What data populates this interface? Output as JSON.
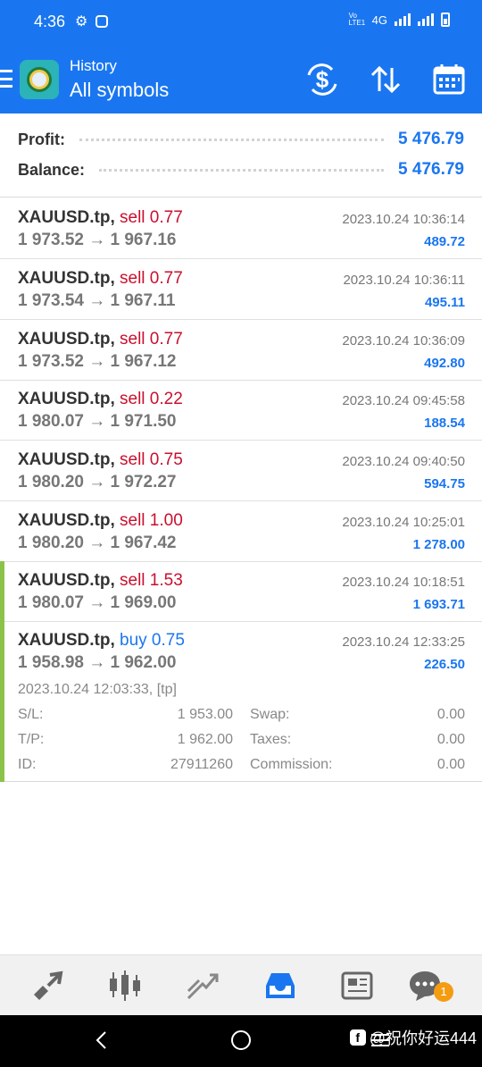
{
  "status_bar": {
    "time": "4:36",
    "icons": [
      "gear-icon",
      "instagram-icon"
    ],
    "network": "4G",
    "volte": "Vo LTE1"
  },
  "app_bar": {
    "subtitle": "History",
    "title": "All symbols",
    "accent_color": "#1a76f0",
    "actions": [
      "currency-exchange-icon",
      "sort-icon",
      "calendar-icon"
    ]
  },
  "summary": {
    "profit_label": "Profit:",
    "profit_value": "5 476.79",
    "balance_label": "Balance:",
    "balance_value": "5 476.79"
  },
  "trades": [
    {
      "symbol": "XAUUSD.tp,",
      "side": "sell 0.77",
      "prices": "1 973.52 → 1 967.16",
      "time": "2023.10.24 10:36:14",
      "profit": "489.72"
    },
    {
      "symbol": "XAUUSD.tp,",
      "side": "sell 0.77",
      "prices": "1 973.54 → 1 967.11",
      "time": "2023.10.24 10:36:11",
      "profit": "495.11"
    },
    {
      "symbol": "XAUUSD.tp,",
      "side": "sell 0.77",
      "prices": "1 973.52 → 1 967.12",
      "time": "2023.10.24 10:36:09",
      "profit": "492.80"
    },
    {
      "symbol": "XAUUSD.tp,",
      "side": "sell 0.22",
      "prices": "1 980.07 → 1 971.50",
      "time": "2023.10.24 09:45:58",
      "profit": "188.54"
    },
    {
      "symbol": "XAUUSD.tp,",
      "side": "sell 0.75",
      "prices": "1 980.20 → 1 972.27",
      "time": "2023.10.24 09:40:50",
      "profit": "594.75"
    },
    {
      "symbol": "XAUUSD.tp,",
      "side": "sell 1.00",
      "prices": "1 980.20 → 1 967.42",
      "time": "2023.10.24 10:25:01",
      "profit": "1 278.00"
    },
    {
      "symbol": "XAUUSD.tp,",
      "side": "sell 1.53",
      "prices": "1 980.07 → 1 969.00",
      "time": "2023.10.24 10:18:51",
      "profit": "1 693.71"
    },
    {
      "symbol": "XAUUSD.tp,",
      "side": "buy 0.75",
      "prices": "1 958.98 → 1 962.00",
      "time": "2023.10.24 12:33:25",
      "profit": "226.50"
    }
  ],
  "expanded_details": {
    "open_info": "2023.10.24 12:03:33, [tp]",
    "sl_label": "S/L:",
    "sl_value": "1 953.00",
    "tp_label": "T/P:",
    "tp_value": "1 962.00",
    "id_label": "ID:",
    "id_value": "27911260",
    "swap_label": "Swap:",
    "swap_value": "0.00",
    "taxes_label": "Taxes:",
    "taxes_value": "0.00",
    "commission_label": "Commission:",
    "commission_value": "0.00"
  },
  "bottom_nav": {
    "items": [
      "quotes-icon",
      "chart-icon",
      "trade-icon",
      "history-icon",
      "news-icon",
      "messages-icon"
    ],
    "active": "history-icon",
    "badge": "1"
  },
  "watermark": "@祝你好运444"
}
